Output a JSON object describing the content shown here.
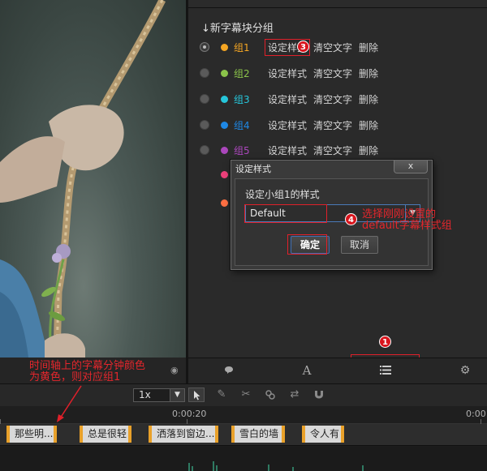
{
  "panel": {
    "heading": "↓新字幕块分组",
    "groups": [
      {
        "name": "组1",
        "color": "#f5a623",
        "checked": true
      },
      {
        "name": "组2",
        "color": "#8bc34a",
        "checked": false
      },
      {
        "name": "组3",
        "color": "#26c6da",
        "checked": false
      },
      {
        "name": "组4",
        "color": "#1e88e5",
        "checked": false
      },
      {
        "name": "组5",
        "color": "#ab47bc",
        "checked": false
      },
      {
        "name": "",
        "color": "#ec407a",
        "checked": false
      },
      {
        "name": "",
        "color": "#ff7043",
        "checked": false
      }
    ],
    "actions": {
      "set_style": "设定样式",
      "clear_text": "清空文字",
      "delete": "删除"
    }
  },
  "dialog": {
    "title": "设定样式",
    "close_symbol": "x",
    "prompt": "设定小组1的样式",
    "selected_style": "Default",
    "ok_label": "确定",
    "cancel_label": "取消"
  },
  "annotations": {
    "badge1": "1",
    "badge2": "2",
    "badge3": "3",
    "badge4": "4",
    "note2_line1": "时间轴上的字幕分钟颜色",
    "note2_line2": "为黄色，则对应组1",
    "note4_line1": "选择刚刚设置的",
    "note4_line2": "default字幕样式组"
  },
  "toolbar": {
    "zoom": "1x"
  },
  "timeline": {
    "ruler_labels": [
      "0:00:20",
      "0:00"
    ],
    "clips": [
      {
        "text": "那些明..."
      },
      {
        "text": "总是很轻"
      },
      {
        "text": "洒落到窗边..."
      },
      {
        "text": "雪白的墙"
      },
      {
        "text": "令人有"
      }
    ]
  },
  "colors": {
    "accent_red": "#e0202a",
    "clip_border": "#e9a12a",
    "dialog_focus": "#4a7ab8"
  },
  "icons": {
    "tabs": [
      "comment-icon",
      "text-style-icon",
      "list-icon",
      "gear-icon"
    ],
    "tools": [
      "pointer-icon",
      "edit-icon",
      "scissors-icon",
      "link-icon",
      "swap-icon",
      "magnet-icon"
    ]
  }
}
